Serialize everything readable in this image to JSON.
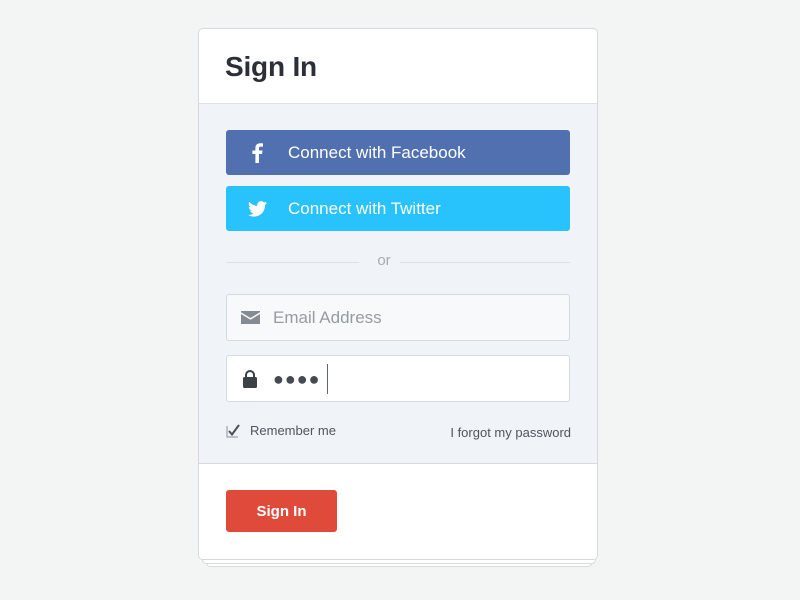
{
  "card": {
    "title": "Sign In"
  },
  "social": {
    "facebook_label": "Connect with Facebook",
    "twitter_label": "Connect with Twitter",
    "facebook_icon": "facebook-icon",
    "twitter_icon": "twitter-icon"
  },
  "divider": {
    "text": "or"
  },
  "form": {
    "email_placeholder": "Email Address",
    "email_value": "",
    "email_icon": "envelope-icon",
    "password_mask": "●●●●",
    "password_icon": "lock-icon",
    "remember_label": "Remember me",
    "remember_checked": true,
    "forgot_label": "I forgot my password"
  },
  "footer": {
    "signin_label": "Sign In"
  },
  "colors": {
    "facebook": "#5170b0",
    "twitter": "#28c2fc",
    "primary": "#e04a3a",
    "page_bg": "#f3f4f4",
    "body_bg": "#f0f3f8"
  }
}
